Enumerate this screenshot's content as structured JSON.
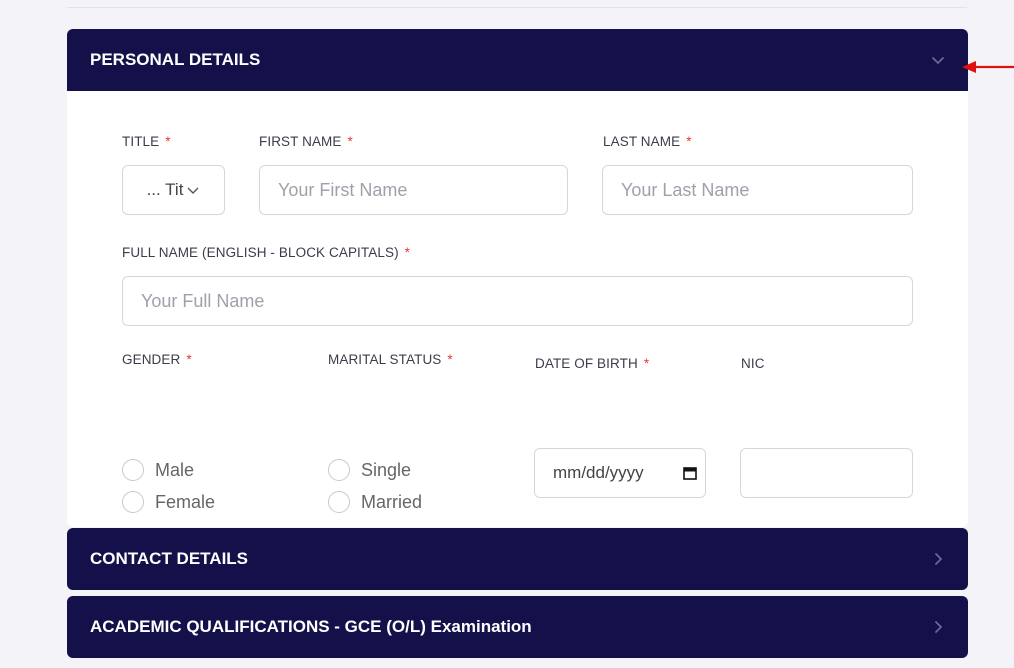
{
  "personal": {
    "title": "PERSONAL DETAILS",
    "labels": {
      "title": "TITLE",
      "first_name": "FIRST NAME",
      "last_name": "LAST NAME",
      "full_name": "FULL NAME (ENGLISH - BLOCK CAPITALS)",
      "gender": "GENDER",
      "marital_status": "MARITAL STATUS",
      "dob": "DATE OF BIRTH",
      "nic": "NIC"
    },
    "required_mark": "*",
    "title_select_value": "... Tit",
    "placeholders": {
      "first_name": "Your First Name",
      "last_name": "Your Last Name",
      "full_name": "Your Full Name"
    },
    "gender_options": [
      "Male",
      "Female"
    ],
    "marital_options": [
      "Single",
      "Married"
    ],
    "dob_value": "mm/dd/yyyy"
  },
  "contact": {
    "title": "CONTACT DETAILS"
  },
  "academic": {
    "title": "ACADEMIC QUALIFICATIONS - GCE (O/L) Examination"
  },
  "colors": {
    "header_bg": "#14114a",
    "required": "#e53935",
    "annotation_arrow": "#e01010"
  },
  "icons": {
    "expanded_toggle": "chevron-down-icon",
    "collapsed_toggle": "chevron-right-icon",
    "select_caret": "chevron-down-icon",
    "date_picker": "calendar-icon",
    "annotation": "arrow-left-icon"
  }
}
